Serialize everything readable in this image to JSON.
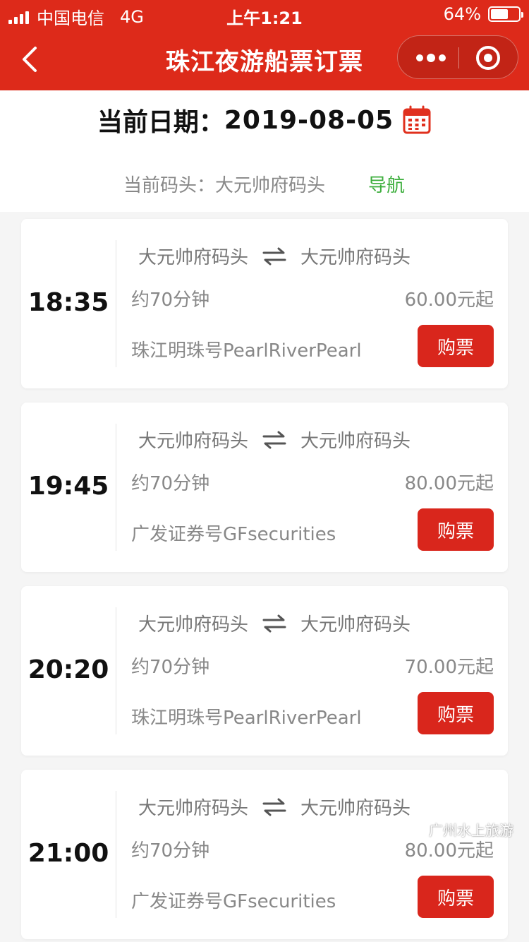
{
  "status_bar": {
    "carrier": "中国电信",
    "network": "4G",
    "time": "上午1:21",
    "battery": "64%",
    "battery_level": 0.64
  },
  "nav": {
    "title": "珠江夜游船票订票",
    "icons": [
      "back-arrow-icon",
      "more-dots-icon",
      "target-icon"
    ]
  },
  "header": {
    "date_label": "当前日期：",
    "date_value": "2019-08-05",
    "pier_text": "当前码头：大元帅府码头",
    "nav_link": "导航"
  },
  "trips": [
    {
      "time": "18:35",
      "from": "大元帅府码头",
      "to": "大元帅府码头",
      "duration": "约70分钟",
      "price": "60.00元起",
      "ship": "珠江明珠号PearlRiverPearl",
      "buy_label": "购票"
    },
    {
      "time": "19:45",
      "from": "大元帅府码头",
      "to": "大元帅府码头",
      "duration": "约70分钟",
      "price": "80.00元起",
      "ship": "广发证券号GFsecurities",
      "buy_label": "购票"
    },
    {
      "time": "20:20",
      "from": "大元帅府码头",
      "to": "大元帅府码头",
      "duration": "约70分钟",
      "price": "70.00元起",
      "ship": "珠江明珠号PearlRiverPearl",
      "buy_label": "购票"
    },
    {
      "time": "21:00",
      "from": "大元帅府码头",
      "to": "大元帅府码头",
      "duration": "约70分钟",
      "price": "80.00元起",
      "ship": "广发证券号GFsecurities",
      "buy_label": "购票"
    }
  ],
  "watermark": {
    "text": "广州水上旅游"
  },
  "colors": {
    "brand_red": "#dd2a1a",
    "button_red": "#d9261c",
    "link_green": "#3cae3c",
    "text_gray": "#888888"
  }
}
